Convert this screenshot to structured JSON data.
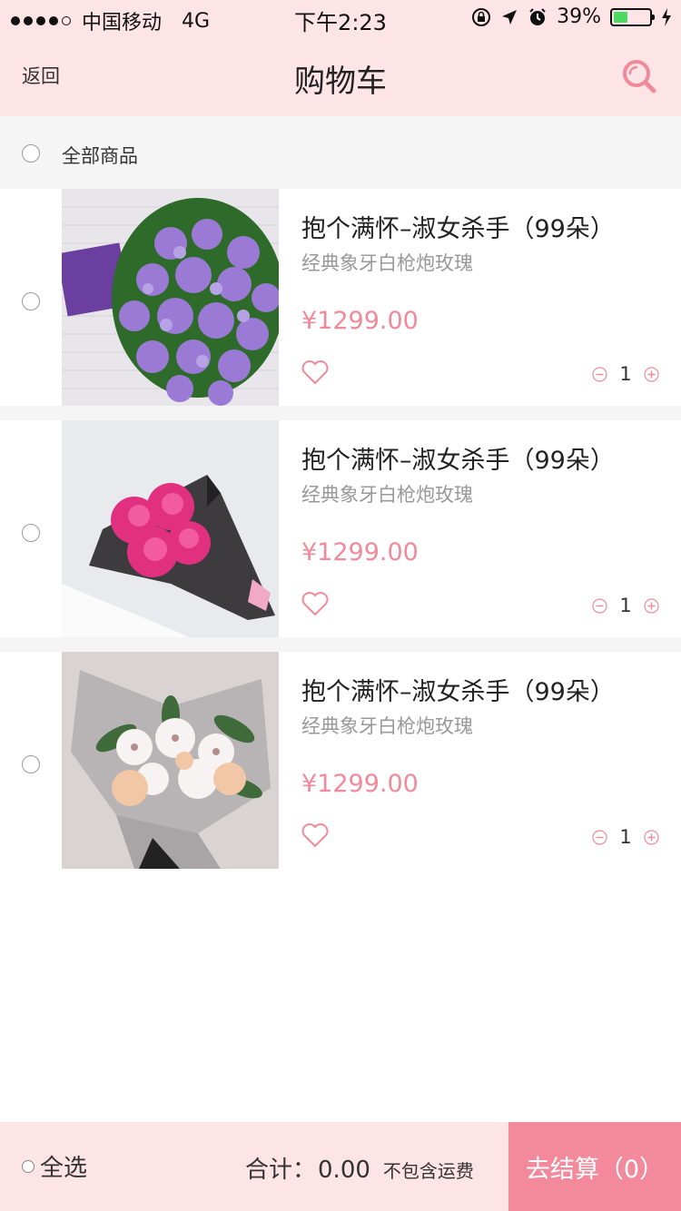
{
  "status_bar": {
    "carrier": "中国移动",
    "network": "4G",
    "time": "下午2:23",
    "battery": "39%",
    "battery_level": 0.39
  },
  "nav": {
    "back_label": "返回",
    "title": "购物车"
  },
  "header": {
    "all_goods_label": "全部商品"
  },
  "items": [
    {
      "name": "抱个满怀–淑女杀手（99朵）",
      "desc": "经典象牙白枪炮玫瑰",
      "price": "¥1299.00",
      "qty": "1"
    },
    {
      "name": "抱个满怀–淑女杀手（99朵）",
      "desc": "经典象牙白枪炮玫瑰",
      "price": "¥1299.00",
      "qty": "1"
    },
    {
      "name": "抱个满怀–淑女杀手（99朵）",
      "desc": "经典象牙白枪炮玫瑰",
      "price": "¥1299.00",
      "qty": "1"
    }
  ],
  "footer": {
    "select_all_label": "全选",
    "total_label": "合计：",
    "total_value": "0.00",
    "shipping_note": "不包含运费",
    "checkout_label": "去结算（0）"
  },
  "colors": {
    "accent": "#f28a9b",
    "header_bg": "#fde4e6",
    "price": "#f08a9a"
  },
  "icons": [
    "search-icon",
    "heart-icon",
    "minus-icon",
    "plus-icon",
    "location-arrow-icon",
    "alarm-icon",
    "charging-icon"
  ]
}
